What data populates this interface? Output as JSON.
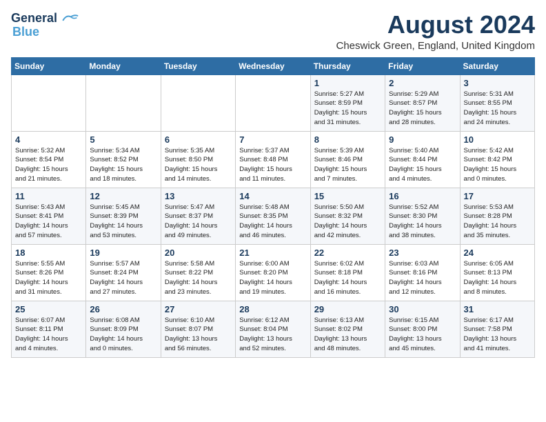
{
  "header": {
    "logo_line1": "General",
    "logo_line2": "Blue",
    "month_year": "August 2024",
    "location": "Cheswick Green, England, United Kingdom"
  },
  "days_of_week": [
    "Sunday",
    "Monday",
    "Tuesday",
    "Wednesday",
    "Thursday",
    "Friday",
    "Saturday"
  ],
  "weeks": [
    [
      {
        "day": "",
        "info": ""
      },
      {
        "day": "",
        "info": ""
      },
      {
        "day": "",
        "info": ""
      },
      {
        "day": "",
        "info": ""
      },
      {
        "day": "1",
        "info": "Sunrise: 5:27 AM\nSunset: 8:59 PM\nDaylight: 15 hours\nand 31 minutes."
      },
      {
        "day": "2",
        "info": "Sunrise: 5:29 AM\nSunset: 8:57 PM\nDaylight: 15 hours\nand 28 minutes."
      },
      {
        "day": "3",
        "info": "Sunrise: 5:31 AM\nSunset: 8:55 PM\nDaylight: 15 hours\nand 24 minutes."
      }
    ],
    [
      {
        "day": "4",
        "info": "Sunrise: 5:32 AM\nSunset: 8:54 PM\nDaylight: 15 hours\nand 21 minutes."
      },
      {
        "day": "5",
        "info": "Sunrise: 5:34 AM\nSunset: 8:52 PM\nDaylight: 15 hours\nand 18 minutes."
      },
      {
        "day": "6",
        "info": "Sunrise: 5:35 AM\nSunset: 8:50 PM\nDaylight: 15 hours\nand 14 minutes."
      },
      {
        "day": "7",
        "info": "Sunrise: 5:37 AM\nSunset: 8:48 PM\nDaylight: 15 hours\nand 11 minutes."
      },
      {
        "day": "8",
        "info": "Sunrise: 5:39 AM\nSunset: 8:46 PM\nDaylight: 15 hours\nand 7 minutes."
      },
      {
        "day": "9",
        "info": "Sunrise: 5:40 AM\nSunset: 8:44 PM\nDaylight: 15 hours\nand 4 minutes."
      },
      {
        "day": "10",
        "info": "Sunrise: 5:42 AM\nSunset: 8:42 PM\nDaylight: 15 hours\nand 0 minutes."
      }
    ],
    [
      {
        "day": "11",
        "info": "Sunrise: 5:43 AM\nSunset: 8:41 PM\nDaylight: 14 hours\nand 57 minutes."
      },
      {
        "day": "12",
        "info": "Sunrise: 5:45 AM\nSunset: 8:39 PM\nDaylight: 14 hours\nand 53 minutes."
      },
      {
        "day": "13",
        "info": "Sunrise: 5:47 AM\nSunset: 8:37 PM\nDaylight: 14 hours\nand 49 minutes."
      },
      {
        "day": "14",
        "info": "Sunrise: 5:48 AM\nSunset: 8:35 PM\nDaylight: 14 hours\nand 46 minutes."
      },
      {
        "day": "15",
        "info": "Sunrise: 5:50 AM\nSunset: 8:32 PM\nDaylight: 14 hours\nand 42 minutes."
      },
      {
        "day": "16",
        "info": "Sunrise: 5:52 AM\nSunset: 8:30 PM\nDaylight: 14 hours\nand 38 minutes."
      },
      {
        "day": "17",
        "info": "Sunrise: 5:53 AM\nSunset: 8:28 PM\nDaylight: 14 hours\nand 35 minutes."
      }
    ],
    [
      {
        "day": "18",
        "info": "Sunrise: 5:55 AM\nSunset: 8:26 PM\nDaylight: 14 hours\nand 31 minutes."
      },
      {
        "day": "19",
        "info": "Sunrise: 5:57 AM\nSunset: 8:24 PM\nDaylight: 14 hours\nand 27 minutes."
      },
      {
        "day": "20",
        "info": "Sunrise: 5:58 AM\nSunset: 8:22 PM\nDaylight: 14 hours\nand 23 minutes."
      },
      {
        "day": "21",
        "info": "Sunrise: 6:00 AM\nSunset: 8:20 PM\nDaylight: 14 hours\nand 19 minutes."
      },
      {
        "day": "22",
        "info": "Sunrise: 6:02 AM\nSunset: 8:18 PM\nDaylight: 14 hours\nand 16 minutes."
      },
      {
        "day": "23",
        "info": "Sunrise: 6:03 AM\nSunset: 8:16 PM\nDaylight: 14 hours\nand 12 minutes."
      },
      {
        "day": "24",
        "info": "Sunrise: 6:05 AM\nSunset: 8:13 PM\nDaylight: 14 hours\nand 8 minutes."
      }
    ],
    [
      {
        "day": "25",
        "info": "Sunrise: 6:07 AM\nSunset: 8:11 PM\nDaylight: 14 hours\nand 4 minutes."
      },
      {
        "day": "26",
        "info": "Sunrise: 6:08 AM\nSunset: 8:09 PM\nDaylight: 14 hours\nand 0 minutes."
      },
      {
        "day": "27",
        "info": "Sunrise: 6:10 AM\nSunset: 8:07 PM\nDaylight: 13 hours\nand 56 minutes."
      },
      {
        "day": "28",
        "info": "Sunrise: 6:12 AM\nSunset: 8:04 PM\nDaylight: 13 hours\nand 52 minutes."
      },
      {
        "day": "29",
        "info": "Sunrise: 6:13 AM\nSunset: 8:02 PM\nDaylight: 13 hours\nand 48 minutes."
      },
      {
        "day": "30",
        "info": "Sunrise: 6:15 AM\nSunset: 8:00 PM\nDaylight: 13 hours\nand 45 minutes."
      },
      {
        "day": "31",
        "info": "Sunrise: 6:17 AM\nSunset: 7:58 PM\nDaylight: 13 hours\nand 41 minutes."
      }
    ]
  ]
}
